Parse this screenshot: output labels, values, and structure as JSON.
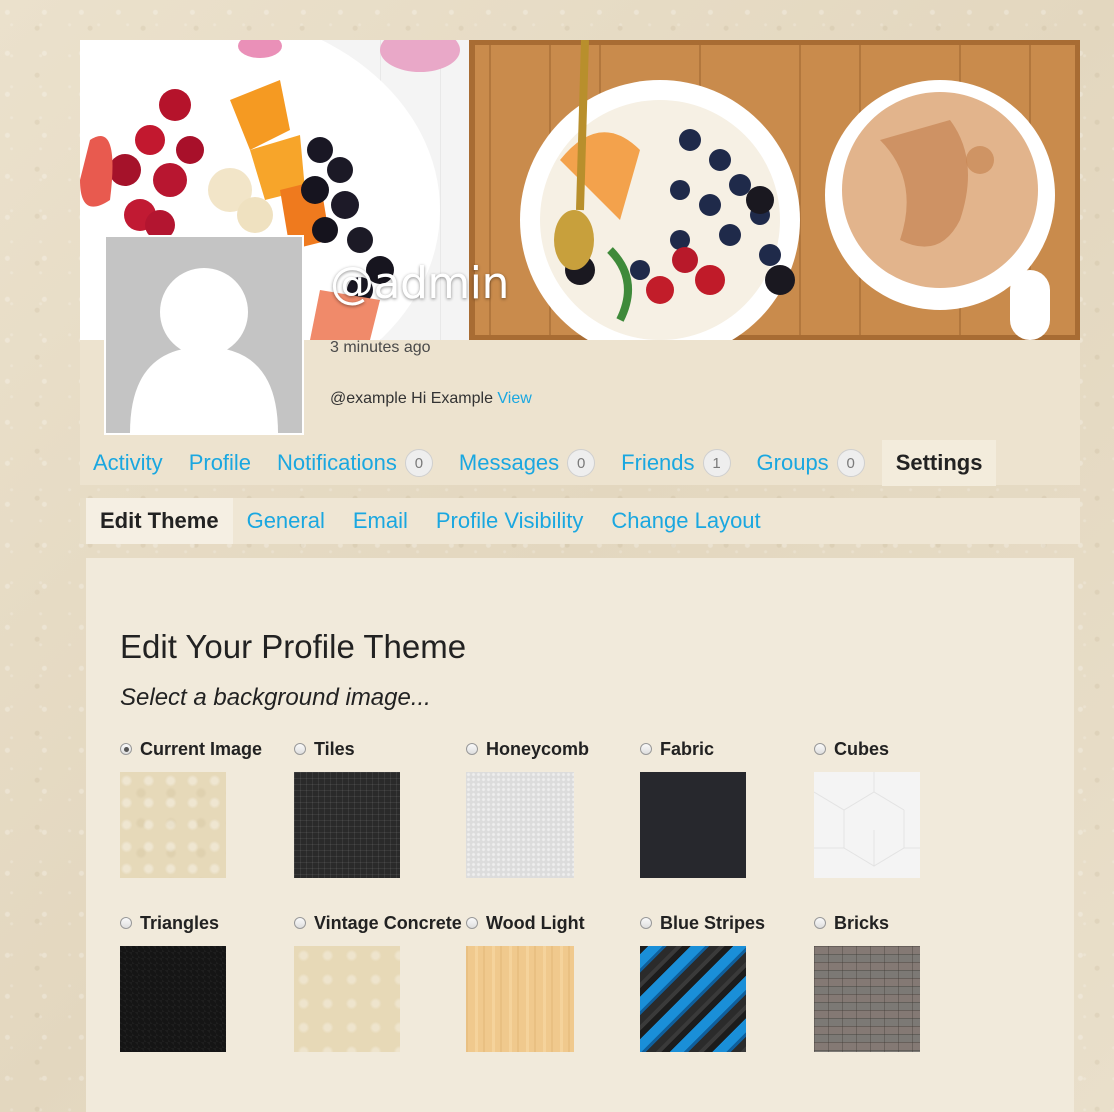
{
  "profile": {
    "handle": "@admin",
    "last_active": "3 minutes ago",
    "latest_activity": {
      "text": "@example Hi Example",
      "link": "View"
    }
  },
  "nav": {
    "items": [
      {
        "label": "Activity",
        "count": null
      },
      {
        "label": "Profile",
        "count": null
      },
      {
        "label": "Notifications",
        "count": "0"
      },
      {
        "label": "Messages",
        "count": "0"
      },
      {
        "label": "Friends",
        "count": "1"
      },
      {
        "label": "Groups",
        "count": "0"
      },
      {
        "label": "Settings",
        "count": null,
        "active": true
      }
    ]
  },
  "subnav": {
    "items": [
      {
        "label": "Edit Theme",
        "active": true
      },
      {
        "label": "General"
      },
      {
        "label": "Email"
      },
      {
        "label": "Profile Visibility"
      },
      {
        "label": "Change Layout"
      }
    ]
  },
  "theme": {
    "title": "Edit Your Profile Theme",
    "subtitle": "Select a background image...",
    "options": [
      {
        "label": "Current Image",
        "checked": true,
        "swatch": "beige"
      },
      {
        "label": "Tiles",
        "checked": false,
        "swatch": "dark-grid"
      },
      {
        "label": "Honeycomb",
        "checked": false,
        "swatch": "light-gray"
      },
      {
        "label": "Fabric",
        "checked": false,
        "swatch": "charcoal"
      },
      {
        "label": "Cubes",
        "checked": false,
        "swatch": "white-cubes"
      },
      {
        "label": "Triangles",
        "checked": false,
        "swatch": "black"
      },
      {
        "label": "Vintage Concrete",
        "checked": false,
        "swatch": "cream"
      },
      {
        "label": "Wood Light",
        "checked": false,
        "swatch": "wood"
      },
      {
        "label": "Blue Stripes",
        "checked": false,
        "swatch": "blue-stripes"
      },
      {
        "label": "Bricks",
        "checked": false,
        "swatch": "gray-bricks"
      }
    ]
  },
  "colors": {
    "link": "#1aa7e0",
    "background": "#e7dcc6"
  }
}
